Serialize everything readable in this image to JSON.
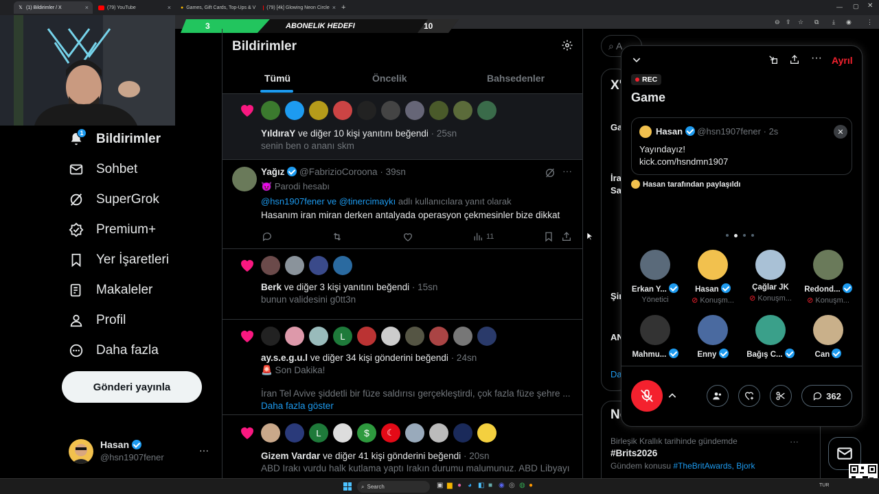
{
  "browser": {
    "tabs": [
      {
        "title": "(1) Bildirimler / X",
        "active": true
      },
      {
        "title": "(79) YouTube",
        "active": false
      },
      {
        "title": "Games, Gift Cards, Top-Ups & V",
        "active": false
      },
      {
        "title": "(79) [4k] Glowing Neon Circle",
        "active": false
      }
    ],
    "new_tab": "+"
  },
  "stream_overlay": {
    "left_value": "3",
    "title": "ABONELIK HEDEFI",
    "right_value": "10"
  },
  "sidebar": {
    "items": [
      {
        "label": "Bildirimler",
        "icon": "bell-icon",
        "badge": "1",
        "active": true
      },
      {
        "label": "Sohbet",
        "icon": "mail-icon"
      },
      {
        "label": "SuperGrok",
        "icon": "grok-icon"
      },
      {
        "label": "Premium+",
        "icon": "premium-icon"
      },
      {
        "label": "Yer İşaretleri",
        "icon": "bookmark-icon"
      },
      {
        "label": "Makaleler",
        "icon": "articles-icon"
      },
      {
        "label": "Profil",
        "icon": "profile-icon"
      },
      {
        "label": "Daha fazla",
        "icon": "more-circle-icon"
      }
    ],
    "post_button": "Gönderi yayınla",
    "account": {
      "name": "Hasan",
      "handle": "@hsn1907fener",
      "more": "···"
    }
  },
  "main": {
    "title": "Bildirimler",
    "tabs": [
      "Tümü",
      "Öncelik",
      "Bahsedenler"
    ],
    "notifications": [
      {
        "type": "like",
        "actor": "YıldıraY",
        "text": " ve diğer 10 kişi yanıtını beğendi",
        "time": "· 25sn",
        "snippet": "senin ben o ananı skm"
      },
      {
        "type": "reply",
        "name": "Yağız",
        "handle": "@FabrizioCoroona",
        "time": "· 39sn",
        "parody": "Parodi hesabı",
        "reply_to_a": "@hsn1907fener",
        "reply_and": " ve ",
        "reply_to_b": "@tinercimaykı",
        "reply_suffix": " adlı kullanıcılara yanıt olarak",
        "body": "Hasanım iran miran derken antalyada operasyon çekmesinler bize dikkat",
        "views": "11"
      },
      {
        "type": "like",
        "actor": "Berk",
        "text": " ve diğer 3 kişi yanıtını beğendi",
        "time": "· 15sn",
        "snippet": "bunun validesini g0tt3n"
      },
      {
        "type": "like",
        "actor": "ay.s.e.g.u.l",
        "text": " ve diğer 34 kişi gönderini beğendi",
        "time": "· 24sn",
        "line1": "🚨 Son Dakika!",
        "line2": "İran Tel Avive şiddetli bir füze saldırısı gerçekleştirdi, çok fazla füze şehre ...",
        "more": "Daha fazla göster"
      },
      {
        "type": "like",
        "actor": "Gizem Vardar",
        "text": " ve diğer 41 kişi gönderini beğendi",
        "time": "· 20sn",
        "snippet": "ABD Irakı vurdu halk kutlama yaptı Irakın durumu malumunuz. ABD Libyayı"
      }
    ]
  },
  "right": {
    "search_placeholder": "A",
    "trend_peek": [
      "X'",
      "Ga",
      "İra",
      "Sa",
      "Şir",
      "AN",
      "Da",
      "No"
    ],
    "trend": {
      "context": "Birleşik Krallık tarihinde gündemde",
      "tag": "#Brits2026",
      "topic_prefix": "Gündem konusu ",
      "topic_links": "#TheBritAwards, Bjork",
      "more": "···"
    }
  },
  "space": {
    "leave": "Ayrıl",
    "rec": "REC",
    "title": "Game",
    "pinned": {
      "name": "Hasan",
      "handle": "@hsn1907fener",
      "time": "· 2s",
      "line1": "Yayındayız!",
      "line2": "kick.com/hsndmn1907"
    },
    "shared_by": "Hasan tarafından paylaşıldı",
    "speakers": [
      {
        "name": "Erkan Y...",
        "role": "Yönetici",
        "verified": true,
        "mic_off": false
      },
      {
        "name": "Hasan",
        "role": "Konuşm...",
        "verified": true,
        "mic_off": true
      },
      {
        "name": "Çağlar JK",
        "role": "Konuşm...",
        "verified": false,
        "mic_off": true
      },
      {
        "name": "Redond...",
        "role": "Konuşm...",
        "verified": true,
        "mic_off": true
      },
      {
        "name": "Mahmu...",
        "role": "",
        "verified": true
      },
      {
        "name": "Enny",
        "role": "",
        "verified": true
      },
      {
        "name": "Bağış C...",
        "role": "",
        "verified": true
      },
      {
        "name": "Can",
        "role": "",
        "verified": true
      }
    ],
    "comments_count": "362"
  },
  "taskbar": {
    "search": "Search",
    "lang": "TUR"
  },
  "colors": {
    "accent": "#1d9bf0",
    "like": "#f91880",
    "rec": "#f4212e",
    "leave": "#f4212e",
    "banner_green": "#22c55e"
  }
}
